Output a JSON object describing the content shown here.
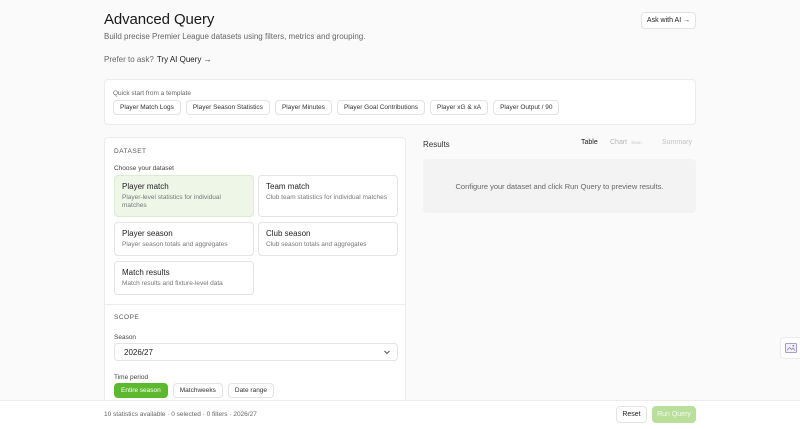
{
  "header": {
    "title": "Advanced Query",
    "subtitle": "Build precise Premier League datasets using filters, metrics and grouping.",
    "ask_ai_label": "Ask with AI →",
    "prefer_text": "Prefer to ask?",
    "try_ai_link": "Try AI Query →"
  },
  "templates": {
    "label": "Quick start from a template",
    "items": [
      "Player Match Logs",
      "Player Season Statistics",
      "Player Minutes",
      "Player Goal Contributions",
      "Player xG & xA",
      "Player Output / 90"
    ]
  },
  "dataset": {
    "heading": "DATASET",
    "choose_label": "Choose your dataset",
    "options": [
      {
        "title": "Player match",
        "desc": "Player-level statistics for individual matches"
      },
      {
        "title": "Team match",
        "desc": "Club team statistics for individual matches"
      },
      {
        "title": "Player season",
        "desc": "Player season totals and aggregates"
      },
      {
        "title": "Club season",
        "desc": "Club season totals and aggregates"
      },
      {
        "title": "Match results",
        "desc": "Match results and fixture-level data"
      }
    ]
  },
  "scope": {
    "heading": "SCOPE",
    "season_label": "Season",
    "season_value": "2026/27",
    "time_period_label": "Time period",
    "periods": [
      "Entire season",
      "Matchweeks",
      "Date range"
    ]
  },
  "results": {
    "heading": "Results",
    "tabs": {
      "table": "Table",
      "chart": "Chart",
      "chart_badge": "Soon",
      "summary": "Summary"
    },
    "empty_message": "Configure your dataset and click Run Query to preview results."
  },
  "footer": {
    "summary": "10 statistics available · 0 selected · 0 filters · 2026/27",
    "reset_label": "Reset",
    "run_label": "Run Query"
  },
  "colors": {
    "accent": "#5cb82d",
    "selected_card_bg": "#eef6e8",
    "run_disabled": "#b9df9a"
  },
  "icons": {
    "season_dropdown": "chevron-down-icon",
    "side_widget": "image-icon"
  }
}
